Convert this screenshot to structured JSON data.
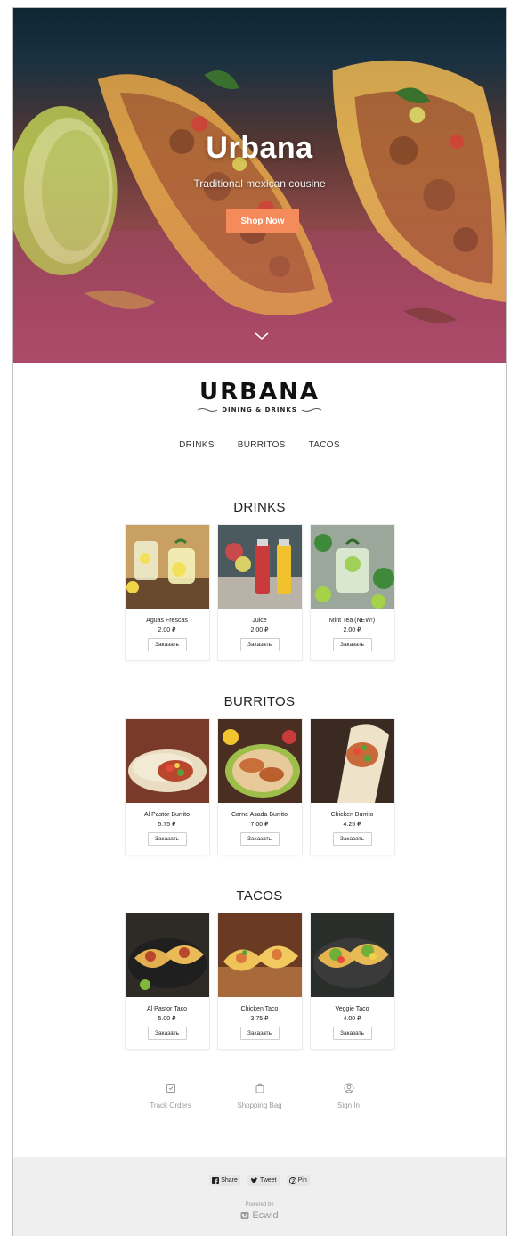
{
  "hero": {
    "title": "Urbana",
    "subtitle": "Traditional mexican cousine",
    "button_label": "Shop Now"
  },
  "logo": {
    "main": "URBANA",
    "tagline": "DINING & DRINKS"
  },
  "nav": {
    "items": [
      {
        "label": "DRINKS"
      },
      {
        "label": "BURRITOS"
      },
      {
        "label": "TACOS"
      }
    ]
  },
  "sections": [
    {
      "title": "DRINKS",
      "products": [
        {
          "name": "Aguas Frescas",
          "price": "2.00 ₽",
          "button": "Заказать"
        },
        {
          "name": "Juice",
          "price": "2.00 ₽",
          "button": "Заказать"
        },
        {
          "name": "Mint Tea (NEW!)",
          "price": "2.00 ₽",
          "button": "Заказать"
        }
      ]
    },
    {
      "title": "BURRITOS",
      "products": [
        {
          "name": "Al Pastor Burrito",
          "price": "5.75 ₽",
          "button": "Заказать"
        },
        {
          "name": "Carne Asada Burrito",
          "price": "7.00 ₽",
          "button": "Заказать"
        },
        {
          "name": "Chicken Burrito",
          "price": "4.25 ₽",
          "button": "Заказать"
        }
      ]
    },
    {
      "title": "TACOS",
      "products": [
        {
          "name": "Al Pastor Taco",
          "price": "5.00 ₽",
          "button": "Заказать"
        },
        {
          "name": "Chicken Taco",
          "price": "3.75 ₽",
          "button": "Заказать"
        },
        {
          "name": "Veggie Taco",
          "price": "4.00 ₽",
          "button": "Заказать"
        }
      ]
    }
  ],
  "account": {
    "track_orders": "Track Orders",
    "shopping_bag": "Shopping Bag",
    "sign_in": "Sign In"
  },
  "footer": {
    "share": "Share",
    "tweet": "Tweet",
    "pin": "Pin",
    "powered_by": "Powered by",
    "brand": "Ecwid"
  },
  "colors": {
    "accent": "#f58a5b",
    "hero_bottom": "#c25a7c"
  }
}
